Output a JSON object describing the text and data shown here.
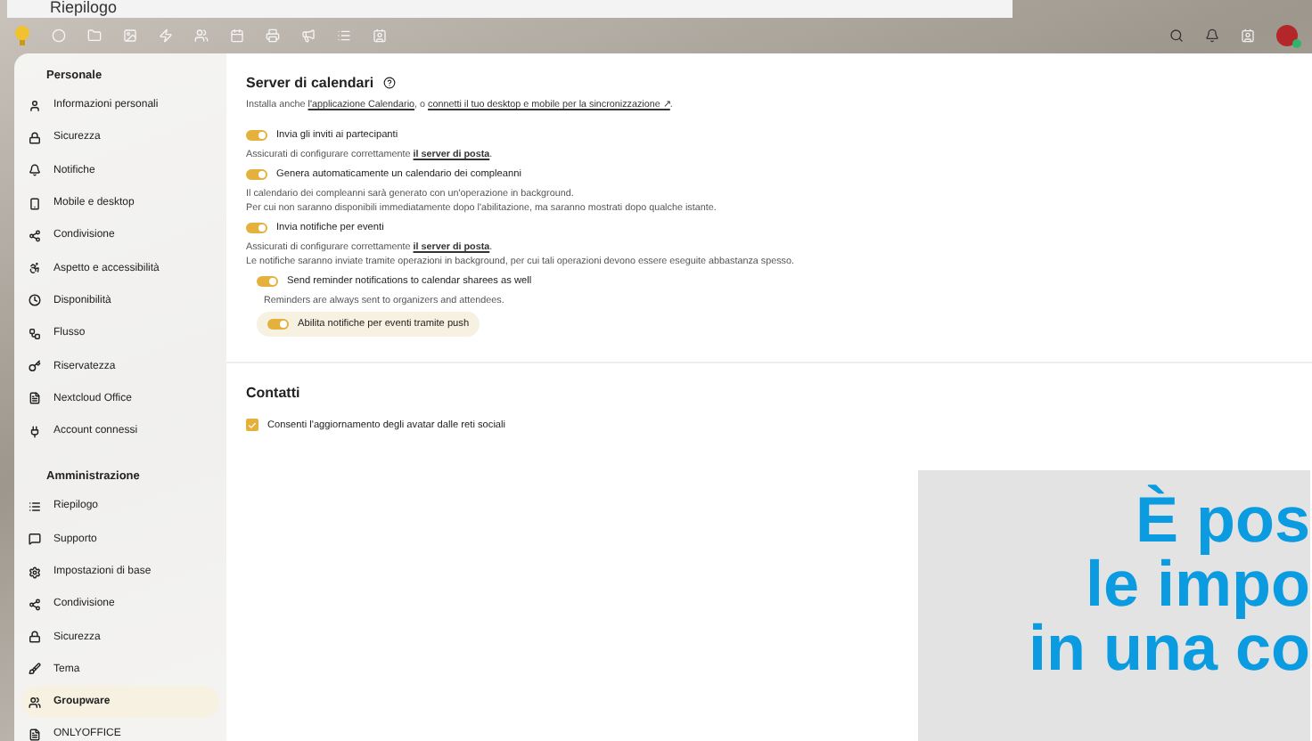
{
  "background_window": {
    "title": "Riepilogo"
  },
  "header": {
    "apps": [
      {
        "kind": "circle"
      },
      {
        "kind": "folder"
      },
      {
        "kind": "image"
      },
      {
        "kind": "bolt"
      },
      {
        "kind": "users"
      },
      {
        "kind": "calendar"
      },
      {
        "kind": "printer"
      },
      {
        "kind": "megaphone"
      },
      {
        "kind": "list"
      },
      {
        "kind": "contact"
      }
    ]
  },
  "sidebar": {
    "sections": [
      {
        "title": "Personale",
        "items": [
          {
            "label": "Informazioni personali",
            "kind": "user",
            "selected": false
          },
          {
            "label": "Sicurezza",
            "kind": "lock",
            "selected": false
          },
          {
            "label": "Notifiche",
            "kind": "bell",
            "selected": false
          },
          {
            "label": "Mobile e desktop",
            "kind": "phone",
            "selected": false
          },
          {
            "label": "Condivisione",
            "kind": "share",
            "selected": false
          },
          {
            "label": "Aspetto e accessibilità",
            "kind": "access",
            "selected": false
          },
          {
            "label": "Disponibilità",
            "kind": "clock",
            "selected": false
          },
          {
            "label": "Flusso",
            "kind": "flow",
            "selected": false
          },
          {
            "label": "Riservatezza",
            "kind": "key",
            "selected": false
          },
          {
            "label": "Nextcloud Office",
            "kind": "doc",
            "selected": false
          },
          {
            "label": "Account connessi",
            "kind": "plug",
            "selected": false
          }
        ]
      },
      {
        "title": "Amministrazione",
        "items": [
          {
            "label": "Riepilogo",
            "kind": "list",
            "selected": false
          },
          {
            "label": "Supporto",
            "kind": "chat",
            "selected": false
          },
          {
            "label": "Impostazioni di base",
            "kind": "gear",
            "selected": false
          },
          {
            "label": "Condivisione",
            "kind": "share",
            "selected": false
          },
          {
            "label": "Sicurezza",
            "kind": "lock",
            "selected": false
          },
          {
            "label": "Tema",
            "kind": "brush",
            "selected": false
          },
          {
            "label": "Groupware",
            "kind": "users",
            "selected": true
          },
          {
            "label": "ONLYOFFICE",
            "kind": "doc",
            "selected": false
          }
        ]
      }
    ]
  },
  "calendar_server": {
    "title": "Server di calendari",
    "intro": {
      "prefix": "Installa anche ",
      "link1": "l'applicazione Calendario",
      "middle": ", o ",
      "link2": "connetti il tuo desktop e mobile per la sincronizzazione ↗",
      "suffix": "."
    },
    "rows": [
      {
        "kind": "toggle",
        "label": "Invia gli inviti ai partecipanti",
        "on": true,
        "indented": false,
        "highlighted": false
      },
      {
        "kind": "hint",
        "prefix": "Assicurati di configurare correttamente ",
        "link": "il server di posta",
        "suffix": ".",
        "indented": false
      },
      {
        "kind": "toggle",
        "label": "Genera automaticamente un calendario dei compleanni",
        "on": true,
        "indented": false,
        "highlighted": false
      },
      {
        "kind": "text",
        "text": "Il calendario dei compleanni sarà generato con un'operazione in background.",
        "indented": false
      },
      {
        "kind": "text",
        "text": "Per cui non saranno disponibili immediatamente dopo l'abilitazione, ma saranno mostrati dopo qualche istante.",
        "indented": false
      },
      {
        "kind": "toggle",
        "label": "Invia notifiche per eventi",
        "on": true,
        "indented": false,
        "highlighted": false
      },
      {
        "kind": "hint",
        "prefix": "Assicurati di configurare correttamente ",
        "link": "il server di posta",
        "suffix": ".",
        "indented": false
      },
      {
        "kind": "text",
        "text": "Le notifiche saranno inviate tramite operazioni in background, per cui tali operazioni devono essere eseguite abbastanza spesso.",
        "indented": false
      },
      {
        "kind": "toggle",
        "label": "Send reminder notifications to calendar sharees as well",
        "on": true,
        "indented": true,
        "highlighted": false
      },
      {
        "kind": "text",
        "text": "Reminders are always sent to organizers and attendees.",
        "indented": true
      },
      {
        "kind": "toggle",
        "label": "Abilita notifiche per eventi tramite push",
        "on": true,
        "indented": true,
        "highlighted": true
      }
    ]
  },
  "contacts": {
    "title": "Contatti",
    "checkbox": {
      "label": "Consenti l'aggiornamento degli avatar dalle reti sociali",
      "checked": true
    }
  },
  "overlay_banner": {
    "lines": [
      "È pos",
      "le impo",
      "in una co"
    ]
  }
}
